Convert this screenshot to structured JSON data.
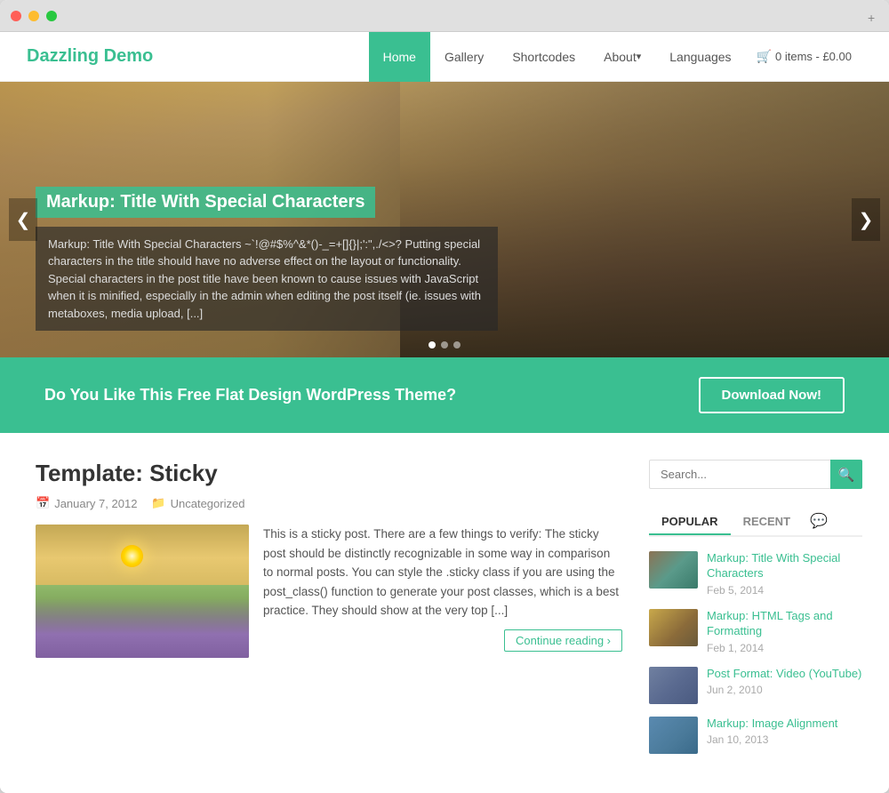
{
  "browser": {
    "dots": [
      "red",
      "yellow",
      "green"
    ],
    "expand_icon": "+"
  },
  "header": {
    "logo": "Dazzling Demo",
    "nav_items": [
      {
        "label": "Home",
        "active": true
      },
      {
        "label": "Gallery",
        "active": false
      },
      {
        "label": "Shortcodes",
        "active": false
      },
      {
        "label": "About",
        "active": false,
        "dropdown": true
      },
      {
        "label": "Languages",
        "active": false
      }
    ],
    "cart": {
      "icon": "🛒",
      "label": "0 items - £0.00"
    }
  },
  "hero": {
    "title": "Markup: Title With Special Characters",
    "text": "Markup: Title With Special Characters ~`!@#$%^&*()-_=+[]{}|;':\",./<>? Putting special characters in the title should have no adverse effect on the layout or functionality. Special characters in the post title have been known to cause issues with JavaScript when it is minified, especially in the admin when editing the post itself (ie. issues with metaboxes, media upload, [...]",
    "arrow_left": "❮",
    "arrow_right": "❯",
    "dots": [
      true,
      false,
      false
    ]
  },
  "cta": {
    "text": "Do You Like This Free Flat Design WordPress Theme?",
    "button": "Download Now!"
  },
  "post": {
    "title": "Template: Sticky",
    "date": "January 7, 2012",
    "category": "Uncategorized",
    "date_icon": "📅",
    "category_icon": "📁",
    "excerpt": "This is a sticky post. There are a few things to verify: The sticky post should be distinctly recognizable in some way in comparison to normal posts. You can style the .sticky class if you are using the post_class() function to generate your post classes, which is a best practice. They should show at the very top [...]",
    "continue_label": "Continue reading ›"
  },
  "sidebar": {
    "search_placeholder": "Search...",
    "search_icon": "🔍",
    "tabs": [
      {
        "label": "POPULAR",
        "active": true
      },
      {
        "label": "RECENT",
        "active": false
      }
    ],
    "tab_icon": "💬",
    "posts": [
      {
        "title": "Markup: Title With Special Characters",
        "date": "Feb 5, 2014",
        "thumb_class": "sidebar-thumb-1"
      },
      {
        "title": "Markup: HTML Tags and Formatting",
        "date": "Feb 1, 2014",
        "thumb_class": "sidebar-thumb-2"
      },
      {
        "title": "Post Format: Video (YouTube)",
        "date": "Jun 2, 2010",
        "thumb_class": "sidebar-thumb-3"
      },
      {
        "title": "Markup: Image Alignment",
        "date": "Jan 10, 2013",
        "thumb_class": "sidebar-thumb-4"
      }
    ]
  }
}
